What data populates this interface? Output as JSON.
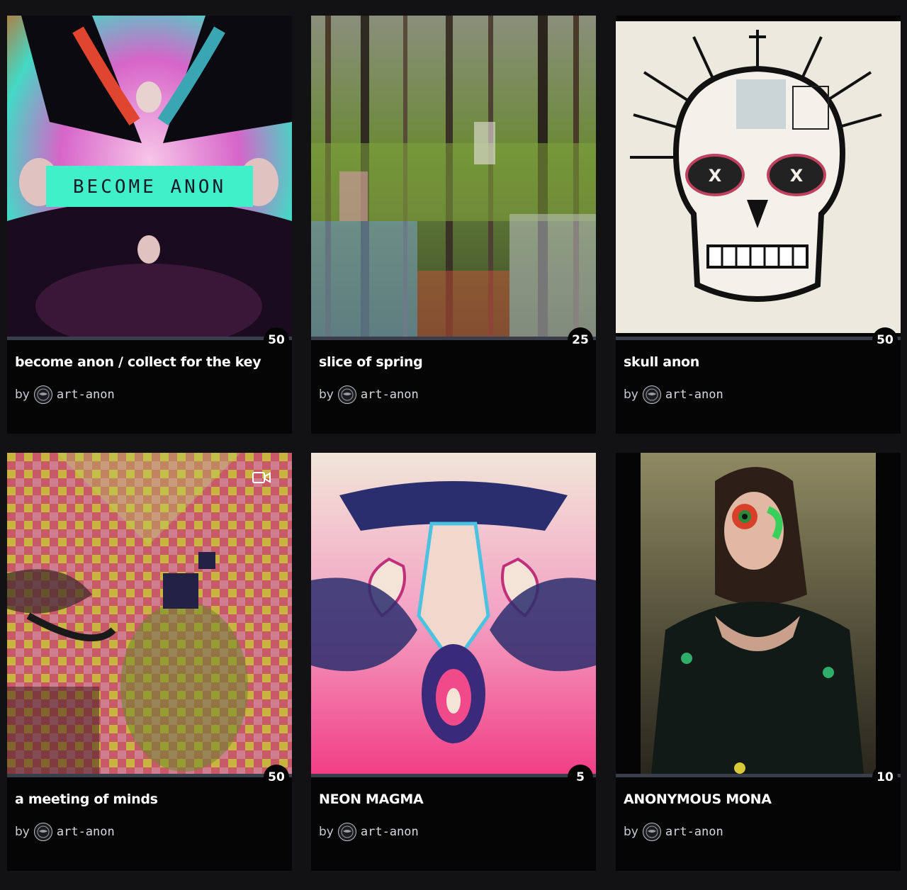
{
  "colors": {
    "background": "#121214",
    "card": "#050506",
    "progress_track": "#3a3d4a"
  },
  "cards": [
    {
      "title": "become anon / collect for the key",
      "edition": "50",
      "by": "by",
      "artist": "art-anon",
      "avatar_icon": "anon-mask-avatar-icon"
    },
    {
      "title": "slice of spring",
      "edition": "25",
      "by": "by",
      "artist": "art-anon",
      "avatar_icon": "anon-mask-avatar-icon"
    },
    {
      "title": "skull anon",
      "edition": "50",
      "by": "by",
      "artist": "art-anon",
      "avatar_icon": "anon-mask-avatar-icon"
    },
    {
      "title": "a meeting of minds",
      "edition": "50",
      "by": "by",
      "artist": "art-anon",
      "avatar_icon": "anon-mask-avatar-icon",
      "media_icon": "video-camera-icon"
    },
    {
      "title": "NEON MAGMA",
      "edition": "5",
      "by": "by",
      "artist": "art-anon",
      "avatar_icon": "anon-mask-avatar-icon"
    },
    {
      "title": "ANONYMOUS MONA",
      "edition": "10",
      "by": "by",
      "artist": "art-anon",
      "avatar_icon": "anon-mask-avatar-icon"
    }
  ]
}
